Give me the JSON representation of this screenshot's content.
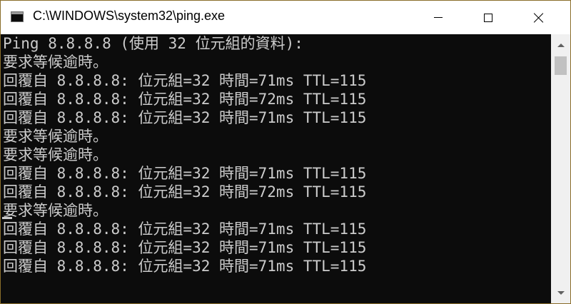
{
  "window": {
    "title": "C:\\WINDOWS\\system32\\ping.exe",
    "border_color": "#8a6d2a",
    "console_bg": "#0c0c0c",
    "console_fg": "#cccccc"
  },
  "icons": {
    "app": "console-app-icon",
    "minimize": "minimize-icon",
    "maximize": "maximize-icon",
    "close": "close-icon",
    "scroll_up": "chevron-up-icon",
    "scroll_down": "chevron-down-icon"
  },
  "console": {
    "lines": [
      "Ping 8.8.8.8 (使用 32 位元組的資料):",
      "要求等候逾時。",
      "回覆自 8.8.8.8: 位元組=32 時間=71ms TTL=115",
      "回覆自 8.8.8.8: 位元組=32 時間=72ms TTL=115",
      "回覆自 8.8.8.8: 位元組=32 時間=71ms TTL=115",
      "要求等候逾時。",
      "要求等候逾時。",
      "回覆自 8.8.8.8: 位元組=32 時間=71ms TTL=115",
      "回覆自 8.8.8.8: 位元組=32 時間=72ms TTL=115",
      "要求等候逾時。",
      "回覆自 8.8.8.8: 位元組=32 時間=71ms TTL=115",
      "回覆自 8.8.8.8: 位元組=32 時間=71ms TTL=115",
      "回覆自 8.8.8.8: 位元組=32 時間=71ms TTL=115"
    ]
  }
}
